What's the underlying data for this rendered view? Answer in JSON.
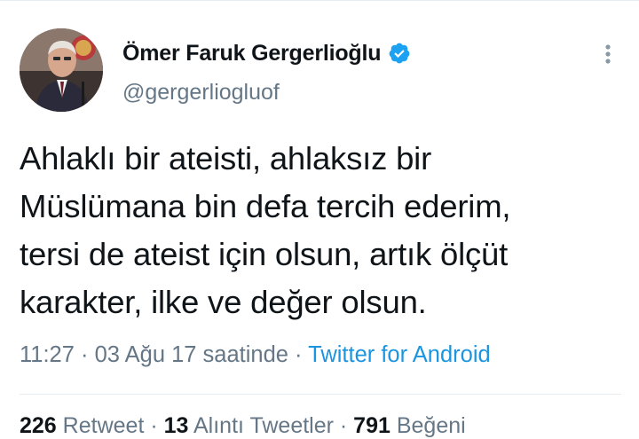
{
  "user": {
    "display_name": "Ömer Faruk Gergerlioğlu",
    "handle": "@gergerliogluof",
    "verified_icon": "verified-badge-icon",
    "avatar": "profile-photo"
  },
  "tweet": {
    "lines": [
      "Ahlaklı bir ateisti, ahlaksız bir",
      "Müslümana bin defa tercih ederim,",
      "tersi de ateist için olsun, artık ölçüt",
      "karakter, ilke ve değer olsun."
    ],
    "time": "11:27",
    "date": "03 Ağu 17 saatinde",
    "separator": " · ",
    "source": "Twitter for Android"
  },
  "stats": {
    "retweets_count": "226",
    "retweets_label": "Retweet",
    "quotes_count": "13",
    "quotes_label": "Alıntı Tweetler",
    "likes_count": "791",
    "likes_label": "Beğeni",
    "separator": " · "
  },
  "more_icon": "more-vertical-icon",
  "colors": {
    "text": "#0f1419",
    "secondary": "#657786",
    "link": "#1b95e0",
    "verified": "#1da1f2",
    "divider": "#e6ecf0"
  }
}
